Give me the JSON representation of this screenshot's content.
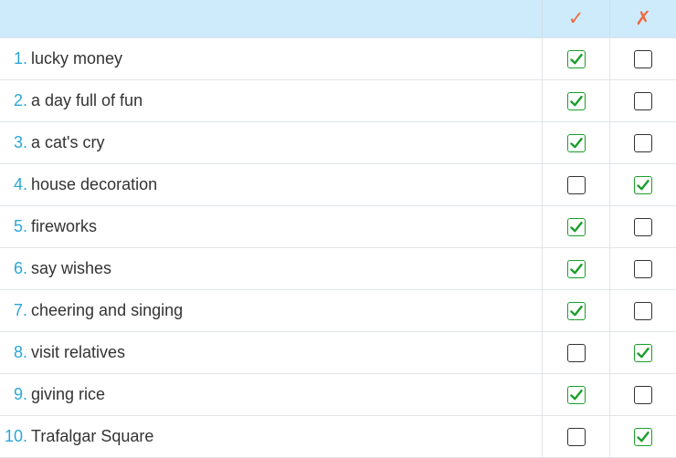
{
  "header": {
    "true_symbol": "✓",
    "false_symbol": "✗"
  },
  "colors": {
    "accent": "#2aa7d8",
    "check": "#1a9e2a",
    "header_bg": "#cdebfb",
    "mark": "#f06a3f"
  },
  "rows": [
    {
      "num": "1.",
      "text": "lucky money",
      "true_checked": true,
      "false_checked": false
    },
    {
      "num": "2.",
      "text": "a day full of fun",
      "true_checked": true,
      "false_checked": false
    },
    {
      "num": "3.",
      "text": "a cat's cry",
      "true_checked": true,
      "false_checked": false
    },
    {
      "num": "4.",
      "text": "house decoration",
      "true_checked": false,
      "false_checked": true
    },
    {
      "num": "5.",
      "text": "fireworks",
      "true_checked": true,
      "false_checked": false
    },
    {
      "num": "6.",
      "text": "say wishes",
      "true_checked": true,
      "false_checked": false
    },
    {
      "num": "7.",
      "text": "cheering and singing",
      "true_checked": true,
      "false_checked": false
    },
    {
      "num": "8.",
      "text": "visit relatives",
      "true_checked": false,
      "false_checked": true
    },
    {
      "num": "9.",
      "text": "giving rice",
      "true_checked": true,
      "false_checked": false
    },
    {
      "num": "10.",
      "text": "Trafalgar Square",
      "true_checked": false,
      "false_checked": true
    }
  ]
}
